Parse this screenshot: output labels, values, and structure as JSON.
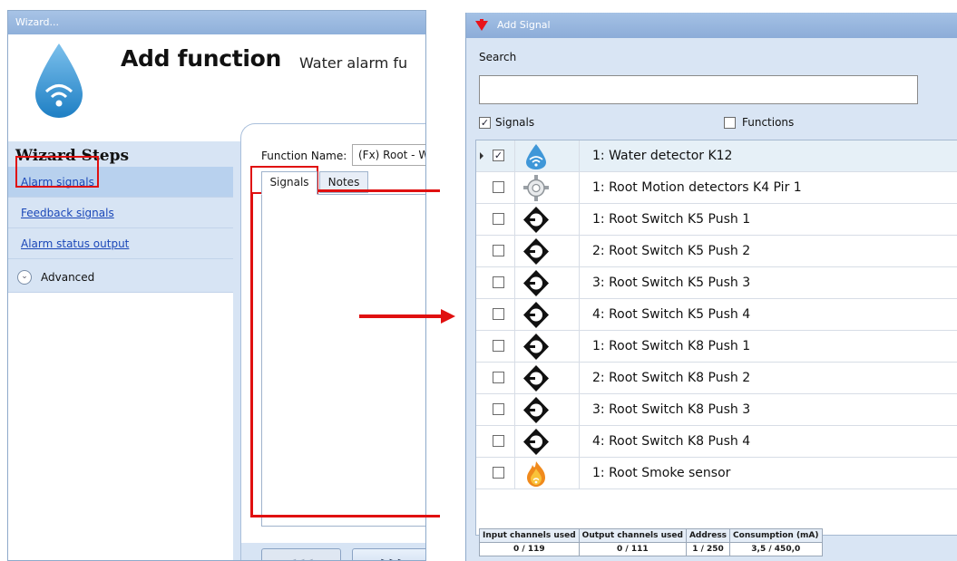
{
  "wizard": {
    "window_title": "Wizard...",
    "title": "Add function",
    "subtitle": "Water alarm fu",
    "steps_title": "Wizard Steps",
    "steps": [
      {
        "label": "Alarm signals",
        "active": true
      },
      {
        "label": "Feedback signals",
        "active": false
      },
      {
        "label": "Alarm status output",
        "active": false
      }
    ],
    "advanced_label": "Advanced",
    "function_name_label": "Function Name:",
    "function_name_value": "(Fx) Root - Wa",
    "tabs": [
      {
        "label": "Signals",
        "selected": true
      },
      {
        "label": "Notes",
        "selected": false
      }
    ],
    "back_label": "<<<",
    "next_label": ">>>"
  },
  "add_signal": {
    "window_title": "Add Signal",
    "search_label": "Search",
    "search_value": "",
    "filters": [
      {
        "label": "Signals",
        "checked": true
      },
      {
        "label": "Functions",
        "checked": false
      }
    ],
    "rows": [
      {
        "label": "1: Water detector K12",
        "icon": "water-drop-icon",
        "checked": true,
        "selected": true
      },
      {
        "label": "1: Root Motion detectors K4 Pir 1",
        "icon": "motion-detector-icon",
        "checked": false,
        "selected": false
      },
      {
        "label": "1: Root Switch K5 Push 1",
        "icon": "push-button-icon",
        "checked": false,
        "selected": false
      },
      {
        "label": "2: Root Switch K5 Push 2",
        "icon": "push-button-icon",
        "checked": false,
        "selected": false
      },
      {
        "label": "3: Root Switch K5 Push 3",
        "icon": "push-button-icon",
        "checked": false,
        "selected": false
      },
      {
        "label": "4: Root Switch K5 Push 4",
        "icon": "push-button-icon",
        "checked": false,
        "selected": false
      },
      {
        "label": "1: Root Switch K8 Push 1",
        "icon": "push-button-icon",
        "checked": false,
        "selected": false
      },
      {
        "label": "2: Root Switch K8 Push 2",
        "icon": "push-button-icon",
        "checked": false,
        "selected": false
      },
      {
        "label": "3: Root Switch K8 Push 3",
        "icon": "push-button-icon",
        "checked": false,
        "selected": false
      },
      {
        "label": "4: Root Switch K8 Push 4",
        "icon": "push-button-icon",
        "checked": false,
        "selected": false
      },
      {
        "label": "1: Root Smoke sensor",
        "icon": "smoke-sensor-icon",
        "checked": false,
        "selected": false
      }
    ],
    "stats": {
      "headers": [
        "Input channels used",
        "Output channels used",
        "Address",
        "Consumption (mA)"
      ],
      "values": [
        "0 / 119",
        "0 / 111",
        "1 / 250",
        "3,5 / 450,0"
      ]
    }
  },
  "colors": {
    "highlight_red": "#e01010",
    "window_blue": "#d7e4f4",
    "link_blue": "#1a47b8"
  }
}
